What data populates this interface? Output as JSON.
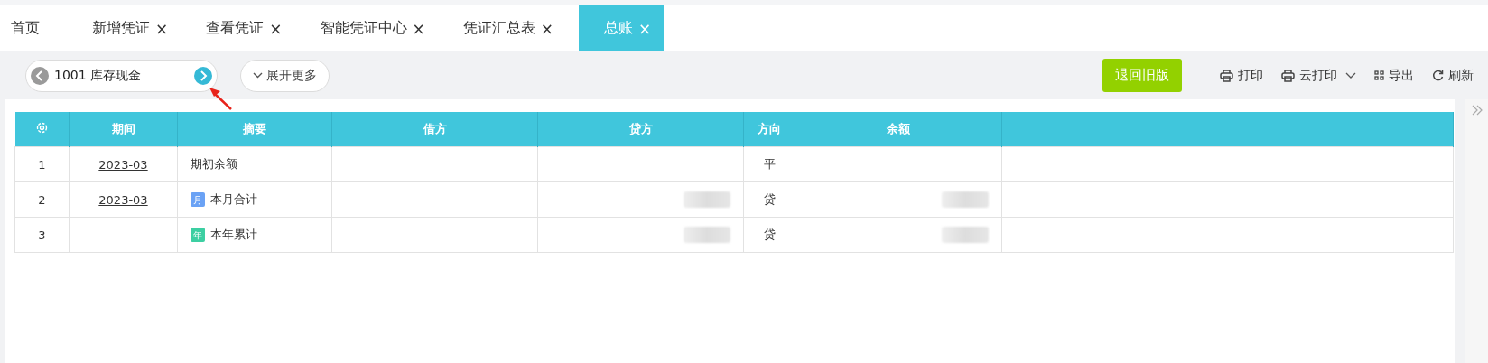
{
  "tabs": [
    {
      "label": "首页",
      "closable": false,
      "selected": false
    },
    {
      "label": "新增凭证",
      "closable": true,
      "selected": false
    },
    {
      "label": "查看凭证",
      "closable": true,
      "selected": false
    },
    {
      "label": "智能凭证中心",
      "closable": true,
      "selected": false
    },
    {
      "label": "凭证汇总表",
      "closable": true,
      "selected": false
    },
    {
      "label": "总账",
      "closable": true,
      "selected": true
    }
  ],
  "close_glyph": "×",
  "account_selector": {
    "value": "1001 库存现金"
  },
  "expand_button": "展开更多",
  "toolbar": [
    {
      "kind": "primary",
      "label": "退回旧版"
    },
    {
      "kind": "print",
      "label": "打印"
    },
    {
      "kind": "cloud-print",
      "label": "云打印"
    },
    {
      "kind": "export",
      "label": "导出"
    },
    {
      "kind": "refresh",
      "label": "刷新"
    }
  ],
  "annotation_arrow": true,
  "table": {
    "columns": [
      "期间",
      "摘要",
      "借方",
      "贷方",
      "方向",
      "余额"
    ],
    "rows": [
      {
        "index": "1",
        "period": "2023-03",
        "summary": "期初余额",
        "summary_icon": null,
        "credit_redacted": false,
        "direction": "平",
        "balance_redacted": false
      },
      {
        "index": "2",
        "period": "2023-03",
        "summary": "本月合计",
        "summary_icon": {
          "kind": "month",
          "label": "月"
        },
        "credit_redacted": true,
        "direction": "贷",
        "balance_redacted": true
      },
      {
        "index": "3",
        "period": "",
        "summary": "本年累计",
        "summary_icon": {
          "kind": "year",
          "label": "年"
        },
        "credit_redacted": true,
        "direction": "贷",
        "balance_redacted": true
      }
    ]
  }
}
